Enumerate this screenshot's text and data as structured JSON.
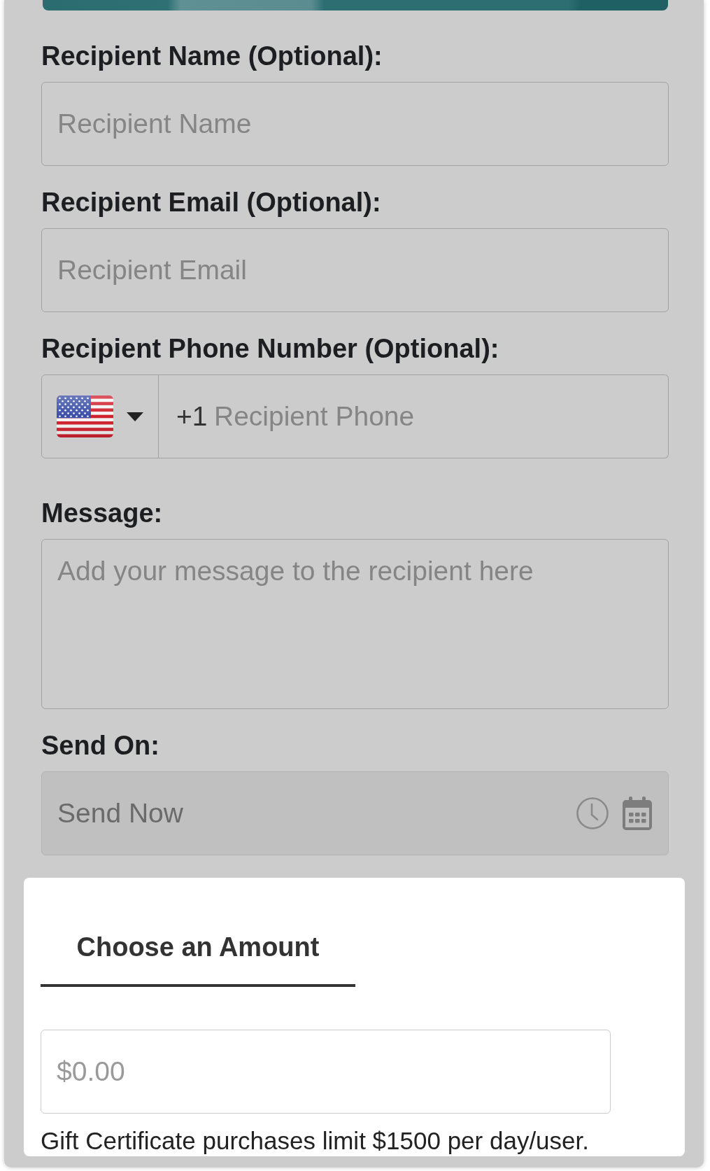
{
  "recipient_form": {
    "fields": [
      {
        "kind": "text",
        "label": "Recipient Name (Optional):",
        "placeholder": "Recipient Name"
      },
      {
        "kind": "text",
        "label": "Recipient Email (Optional):",
        "placeholder": "Recipient Email"
      },
      {
        "kind": "phone",
        "label": "Recipient Phone Number (Optional):",
        "dial_code": "+1",
        "placeholder": "Recipient Phone"
      },
      {
        "kind": "textarea",
        "label": "Message:",
        "placeholder": "Add your message to the recipient here"
      },
      {
        "kind": "schedule",
        "label": "Send On:",
        "value": "Send Now",
        "disabled": true
      }
    ]
  },
  "amount_section": {
    "tabs": [
      {
        "label": "Choose an Amount",
        "selected": true
      }
    ],
    "amount_field": {
      "placeholder": "$0.00"
    },
    "note": "Gift Certificate purchases limit $1500 per day/user."
  }
}
